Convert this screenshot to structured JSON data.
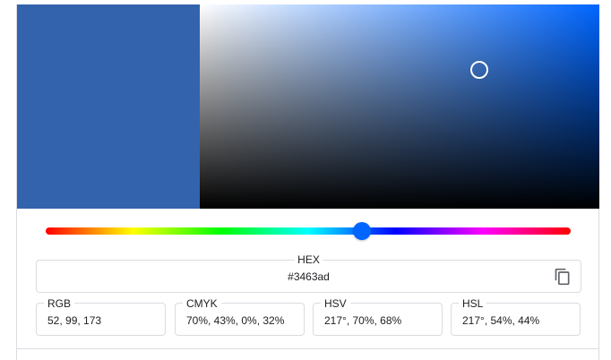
{
  "color": {
    "current": "#3463ad",
    "hue_color": "#0066ff",
    "saturation": 0.7,
    "value": 0.68,
    "hue_fraction": 0.603
  },
  "hex": {
    "label": "HEX",
    "value": "#3463ad",
    "copy_icon": "copy-icon"
  },
  "formats": [
    {
      "label": "RGB",
      "value": "52, 99, 173"
    },
    {
      "label": "CMYK",
      "value": "70%, 43%, 0%, 32%"
    },
    {
      "label": "HSV",
      "value": "217°, 70%, 68%"
    },
    {
      "label": "HSL",
      "value": "217°, 54%, 44%"
    }
  ]
}
